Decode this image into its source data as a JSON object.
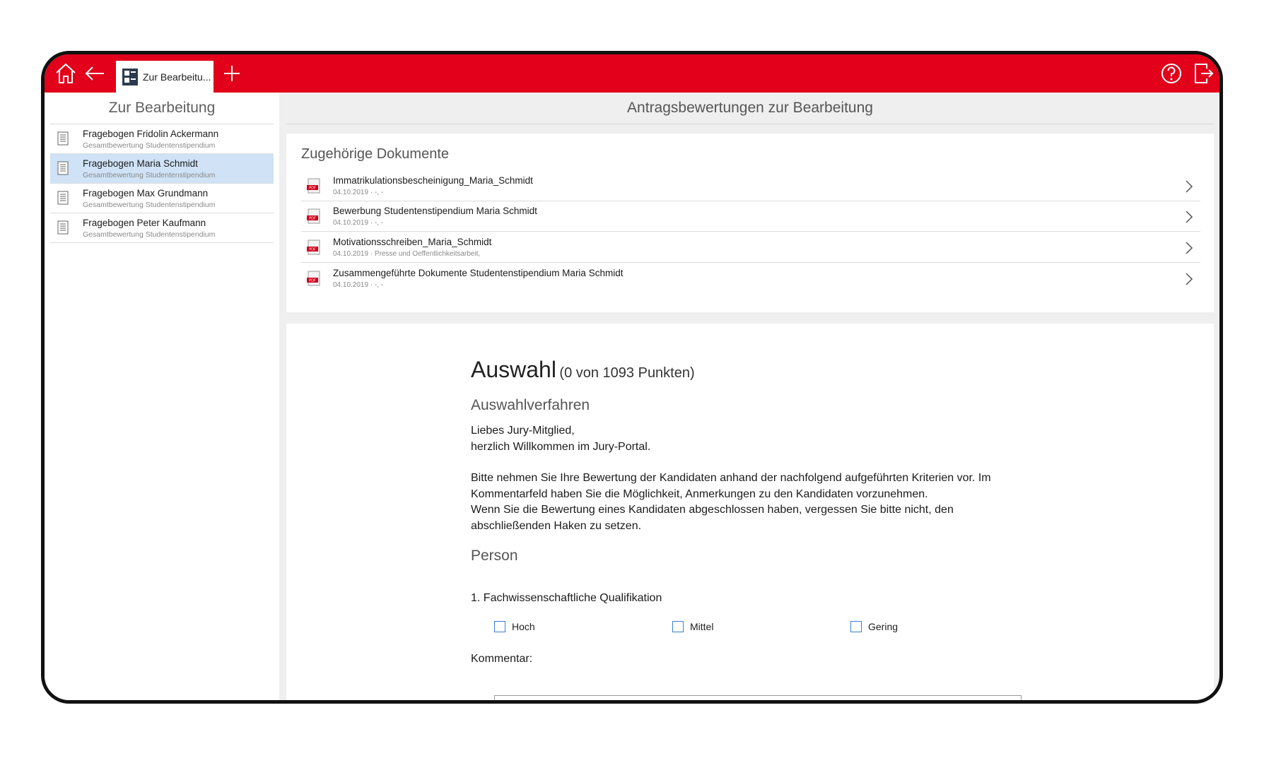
{
  "topbar": {
    "tab_label": "Zur Bearbeitu...",
    "accent_color": "#e2001a",
    "icons": [
      "home-icon",
      "back-arrow-icon",
      "form-icon",
      "plus-icon",
      "help-icon",
      "logout-icon"
    ]
  },
  "sidebar": {
    "title": "Zur Bearbeitung",
    "items": [
      {
        "name": "Fragebogen Fridolin Ackermann",
        "sub": "Gesamtbewertung Studentenstipendium",
        "selected": false
      },
      {
        "name": "Fragebogen Maria Schmidt",
        "sub": "Gesamtbewertung Studentenstipendium",
        "selected": true
      },
      {
        "name": "Fragebogen Max Grundmann",
        "sub": "Gesamtbewertung Studentenstipendium",
        "selected": false
      },
      {
        "name": "Fragebogen Peter Kaufmann",
        "sub": "Gesamtbewertung Studentenstipendium",
        "selected": false
      }
    ]
  },
  "main": {
    "header": "Antragsbewertungen zur Bearbeitung",
    "documents": {
      "title": "Zugehörige Dokumente",
      "items": [
        {
          "name": "Immatrikulationsbescheinigung_Maria_Schmidt",
          "sub": "04.10.2019 · -, -"
        },
        {
          "name": "Bewerbung Studentenstipendium Maria Schmidt",
          "sub": "04.10.2019 · -, -"
        },
        {
          "name": "Motivationsschreiben_Maria_Schmidt",
          "sub": "04.10.2019 · Presse und Oeffentlichkeitsarbeit,"
        },
        {
          "name": "Zusammengeführte Dokumente Studentenstipendium Maria Schmidt",
          "sub": "04.10.2019 · -, -"
        }
      ]
    },
    "form": {
      "title": "Auswahl",
      "points": "(0 von 1093 Punkten)",
      "section1": "Auswahlverfahren",
      "greeting1": "Liebes Jury-Mitglied,",
      "greeting2": "herzlich Willkommen im Jury-Portal.",
      "body1": "Bitte nehmen Sie Ihre Bewertung der Kandidaten anhand der nachfolgend aufgeführten Kriterien vor. Im",
      "body2": "Kommentarfeld haben Sie die Möglichkeit, Anmerkungen zu den Kandidaten vorzunehmen.",
      "body3": "Wenn Sie die Bewertung eines Kandidaten abgeschlossen haben, vergessen Sie bitte nicht, den",
      "body4": "abschließenden Haken zu setzen.",
      "section2": "Person",
      "question1": "1. Fachwissenschaftliche Qualifikation",
      "options": [
        "Hoch",
        "Mittel",
        "Gering"
      ],
      "comment_label": "Kommentar:"
    }
  }
}
